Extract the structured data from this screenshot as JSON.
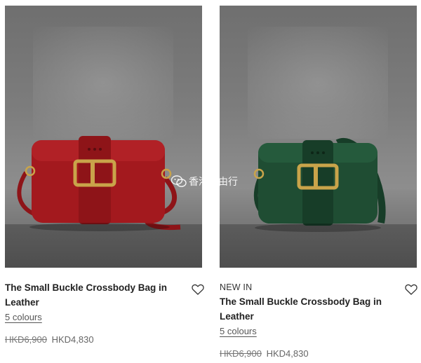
{
  "products": [
    {
      "badge": "",
      "title": "The Small Buckle Crossbody Bag in Leather",
      "colours": "5 colours",
      "old_price": "HKD6,900",
      "new_price": "HKD4,830",
      "bag_color": "#a3191e",
      "icons": {
        "wishlist": "heart-outline-icon"
      }
    },
    {
      "badge": "NEW IN",
      "title": "The Small Buckle Crossbody Bag in Leather",
      "colours": "5 colours",
      "old_price": "HKD6,900",
      "new_price": "HKD4,830",
      "bag_color": "#1f4d33",
      "icons": {
        "wishlist": "heart-outline-icon"
      }
    }
  ],
  "watermark": {
    "text": "香港自由行",
    "icon": "wechat-icon"
  }
}
